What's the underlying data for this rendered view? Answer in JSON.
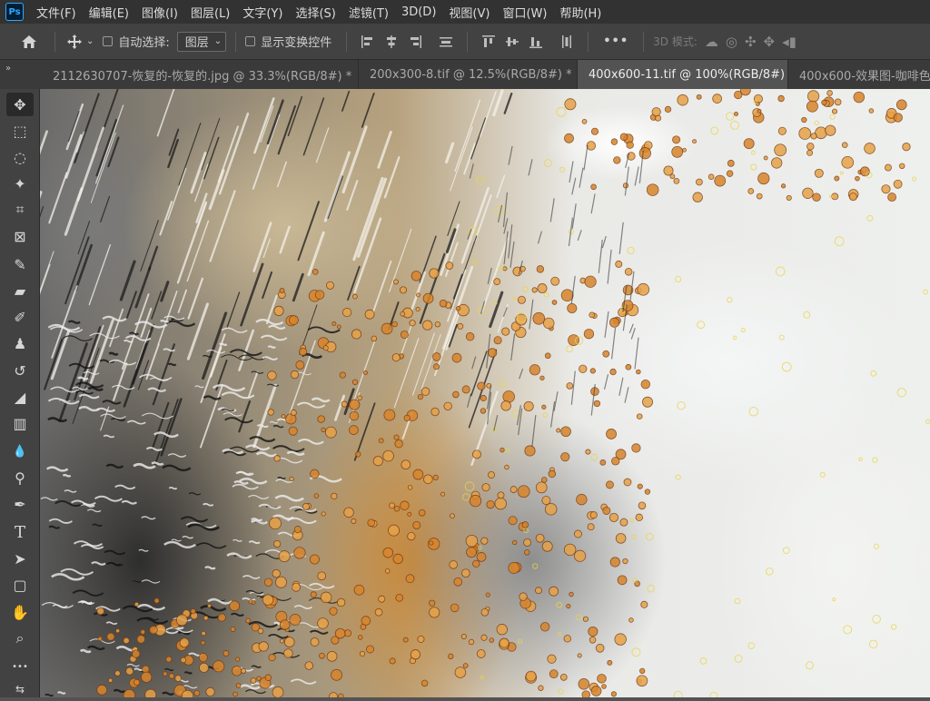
{
  "app": {
    "logo": "Ps"
  },
  "menu": [
    {
      "id": "file",
      "label": "文件(F)"
    },
    {
      "id": "edit",
      "label": "编辑(E)"
    },
    {
      "id": "image",
      "label": "图像(I)"
    },
    {
      "id": "layer",
      "label": "图层(L)"
    },
    {
      "id": "type",
      "label": "文字(Y)"
    },
    {
      "id": "select",
      "label": "选择(S)"
    },
    {
      "id": "filter",
      "label": "滤镜(T)"
    },
    {
      "id": "3d",
      "label": "3D(D)"
    },
    {
      "id": "view",
      "label": "视图(V)"
    },
    {
      "id": "window",
      "label": "窗口(W)"
    },
    {
      "id": "help",
      "label": "帮助(H)"
    }
  ],
  "options": {
    "auto_select_label": "自动选择:",
    "auto_select_checked": false,
    "auto_select_target": "图层",
    "show_transform_label": "显示变换控件",
    "show_transform_checked": false,
    "more_label": "•••",
    "mode_3d_label": "3D 模式:"
  },
  "tabs": [
    {
      "label": "2112630707-恢复的-恢复的.jpg @ 33.3%(RGB/8#) *",
      "active": false
    },
    {
      "label": "200x300-8.tif @ 12.5%(RGB/8#) *",
      "active": false
    },
    {
      "label": "400x600-11.tif @ 100%(RGB/8#)",
      "active": true
    },
    {
      "label": "400x600-效果图-咖啡色",
      "active": false
    }
  ],
  "tab_collapse": "»",
  "tab_close_glyph": "×",
  "tools": [
    {
      "id": "move",
      "icon": "move-icon",
      "glyph": "✥",
      "active": true
    },
    {
      "id": "marquee",
      "icon": "rect-marquee-icon",
      "glyph": "⬚"
    },
    {
      "id": "lasso",
      "icon": "lasso-icon",
      "glyph": "◌"
    },
    {
      "id": "magic-wand",
      "icon": "magic-wand-icon",
      "glyph": "✦"
    },
    {
      "id": "crop",
      "icon": "crop-icon",
      "glyph": "⌗"
    },
    {
      "id": "frame",
      "icon": "frame-icon",
      "glyph": "⊠"
    },
    {
      "id": "eyedropper",
      "icon": "eyedropper-icon",
      "glyph": "✎"
    },
    {
      "id": "heal",
      "icon": "healing-brush-icon",
      "glyph": "▰"
    },
    {
      "id": "brush",
      "icon": "brush-icon",
      "glyph": "✐"
    },
    {
      "id": "stamp",
      "icon": "clone-stamp-icon",
      "glyph": "♟"
    },
    {
      "id": "history-brush",
      "icon": "history-brush-icon",
      "glyph": "↺"
    },
    {
      "id": "eraser",
      "icon": "eraser-icon",
      "glyph": "◢"
    },
    {
      "id": "gradient",
      "icon": "gradient-icon",
      "glyph": "▥"
    },
    {
      "id": "blur",
      "icon": "blur-icon",
      "glyph": "💧"
    },
    {
      "id": "dodge",
      "icon": "dodge-icon",
      "glyph": "⚲"
    },
    {
      "id": "pen",
      "icon": "pen-icon",
      "glyph": "✒"
    },
    {
      "id": "type",
      "icon": "type-icon",
      "glyph": "T"
    },
    {
      "id": "path-select",
      "icon": "path-select-icon",
      "glyph": "➤"
    },
    {
      "id": "shape",
      "icon": "rect-shape-icon",
      "glyph": "▢"
    },
    {
      "id": "hand",
      "icon": "hand-icon",
      "glyph": "✋"
    },
    {
      "id": "zoom",
      "icon": "zoom-icon",
      "glyph": "⌕"
    },
    {
      "id": "more-tools",
      "icon": "more-tools-icon",
      "glyph": "•••"
    },
    {
      "id": "swap-colors",
      "icon": "swap-colors-icon",
      "glyph": "⇆"
    }
  ],
  "colors": {
    "menubar_bg": "#323232",
    "panel_bg": "#424242",
    "workspace_bg": "#535353",
    "ps_blue": "#31a8ff",
    "rust_orange": "#d7852c"
  }
}
